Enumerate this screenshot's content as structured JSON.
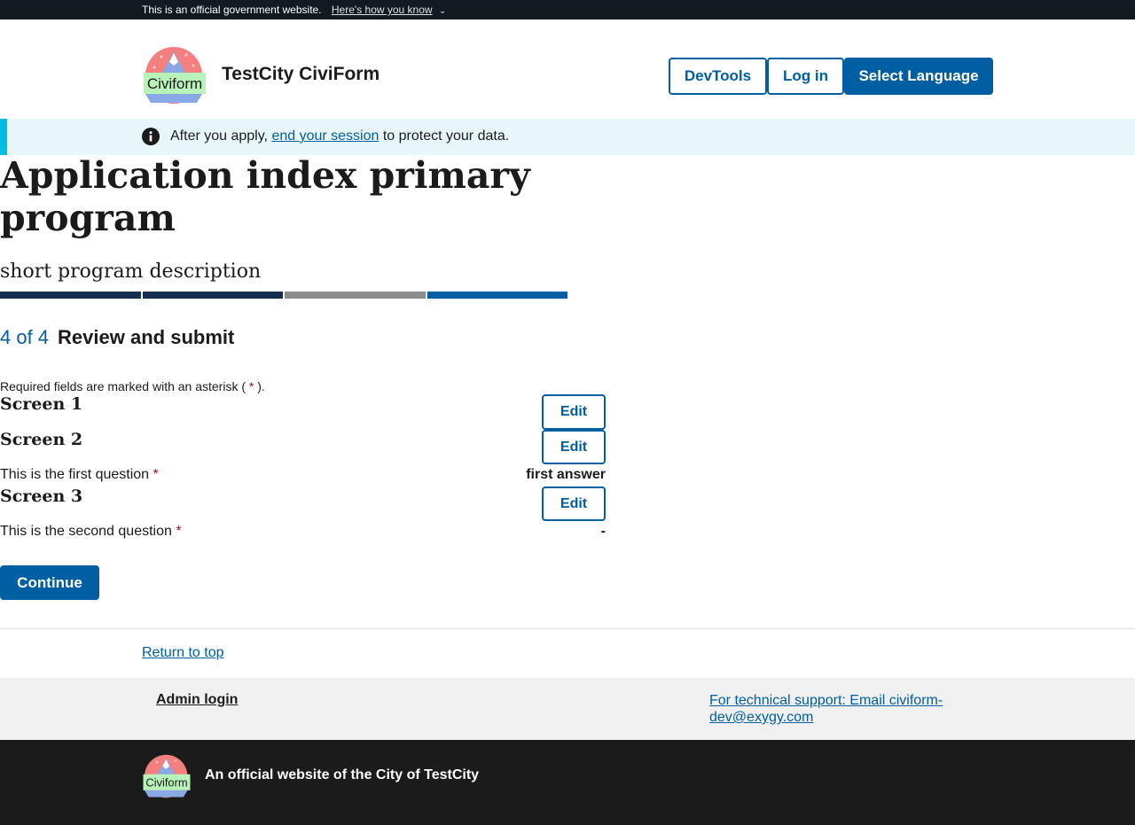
{
  "gov_banner": {
    "text": "This is an official government website.",
    "link": "Here's how you know",
    "icon": "chevron-down-icon"
  },
  "header": {
    "logo_text": "Civiform",
    "site_title": "TestCity CiviForm",
    "buttons": {
      "devtools": "DevTools",
      "login": "Log in",
      "language": "Select Language"
    }
  },
  "alert": {
    "icon": "info-icon",
    "before": "After you apply,",
    "link": "end your session",
    "after": "to protect your data."
  },
  "program": {
    "title": "Application index primary program",
    "description": "short program description",
    "progress_colors": [
      "#162e51",
      "#162e51",
      "#8d8d8d",
      "#005ea2"
    ]
  },
  "step": {
    "count": "4 of 4",
    "name": "Review and submit"
  },
  "required_note": {
    "before": "Required fields are marked with an asterisk (",
    "asterisk": "*",
    "after": ")."
  },
  "screens": [
    {
      "title": "Screen 1",
      "edit": "Edit"
    },
    {
      "title": "Screen 2",
      "edit": "Edit",
      "question": "This is the first question",
      "asterisk": "*",
      "answer": "first answer"
    },
    {
      "title": "Screen 3",
      "edit": "Edit",
      "question": "This is the second question",
      "asterisk": "*",
      "answer": "-"
    }
  ],
  "continue_button": "Continue",
  "return_to_top": "Return to top",
  "footer": {
    "admin_login": "Admin login",
    "support": "For technical support: Email civiform-dev@exygy.com",
    "logo_text": "Civiform",
    "official_text": "An official website of the City of TestCity"
  },
  "colors": {
    "primary": "#005ea2",
    "dark_banner": "#111921",
    "alert_bg": "#e7f6f8",
    "alert_border": "#00bde3",
    "required": "#b50909",
    "footer_bg": "#1b1b1b"
  }
}
